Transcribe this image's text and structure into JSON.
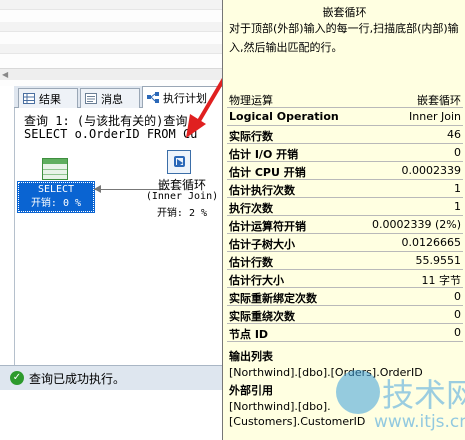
{
  "tabs": [
    {
      "label": "结果",
      "icon": "grid-icon"
    },
    {
      "label": "消息",
      "icon": "message-icon"
    },
    {
      "label": "执行计划",
      "icon": "plan-icon"
    }
  ],
  "query": {
    "line1": "查询 1: (与该批有关的)查询",
    "line2": "SELECT o.OrderID FROM Cu"
  },
  "plan": {
    "select_label": "SELECT",
    "select_cost": "开销: 0 %",
    "loop_label": "嵌套循环",
    "loop_sub": "(Inner Join)",
    "loop_cost": "开销: 2 %"
  },
  "status": {
    "text": "查询已成功执行。",
    "icon": "check-icon"
  },
  "tooltip": {
    "title": "嵌套循环",
    "description": "对于顶部(外部)输入的每一行,扫描底部(内部)输入,然后输出匹配的行。",
    "physical_label": "物理运算",
    "physical_value": "嵌套循环",
    "rows": [
      {
        "label": "Logical Operation",
        "value": "Inner Join"
      },
      {
        "label": "实际行数",
        "value": "46"
      },
      {
        "label": "估计 I/O 开销",
        "value": "0"
      },
      {
        "label": "估计 CPU 开销",
        "value": "0.0002339"
      },
      {
        "label": "估计执行次数",
        "value": "1"
      },
      {
        "label": "执行次数",
        "value": "1"
      },
      {
        "label": "估计运算符开销",
        "value": "0.0002339 (2%)"
      },
      {
        "label": "估计子树大小",
        "value": "0.0126665"
      },
      {
        "label": "估计行数",
        "value": "55.9551"
      },
      {
        "label": "估计行大小",
        "value": "11 字节"
      },
      {
        "label": "实际重新绑定次数",
        "value": "0"
      },
      {
        "label": "实际重绕次数",
        "value": "0"
      },
      {
        "label": "节点 ID",
        "value": "0"
      }
    ],
    "output_title": "输出列表",
    "output_ref": "[Northwind].[dbo].[Orders].OrderID",
    "outer_title": "外部引用",
    "outer_ref1": "[Northwind].[dbo].",
    "outer_ref2": "[Customers].CustomerID"
  },
  "watermark": {
    "brand": "技术网",
    "url": "www.itjs.cn"
  },
  "colors": {
    "tooltip_bg": "#ffffe1",
    "select_node_bg": "#0a64d2",
    "status_bar_bg": "#dee6ef",
    "annotation_arrow": "#e02020"
  }
}
